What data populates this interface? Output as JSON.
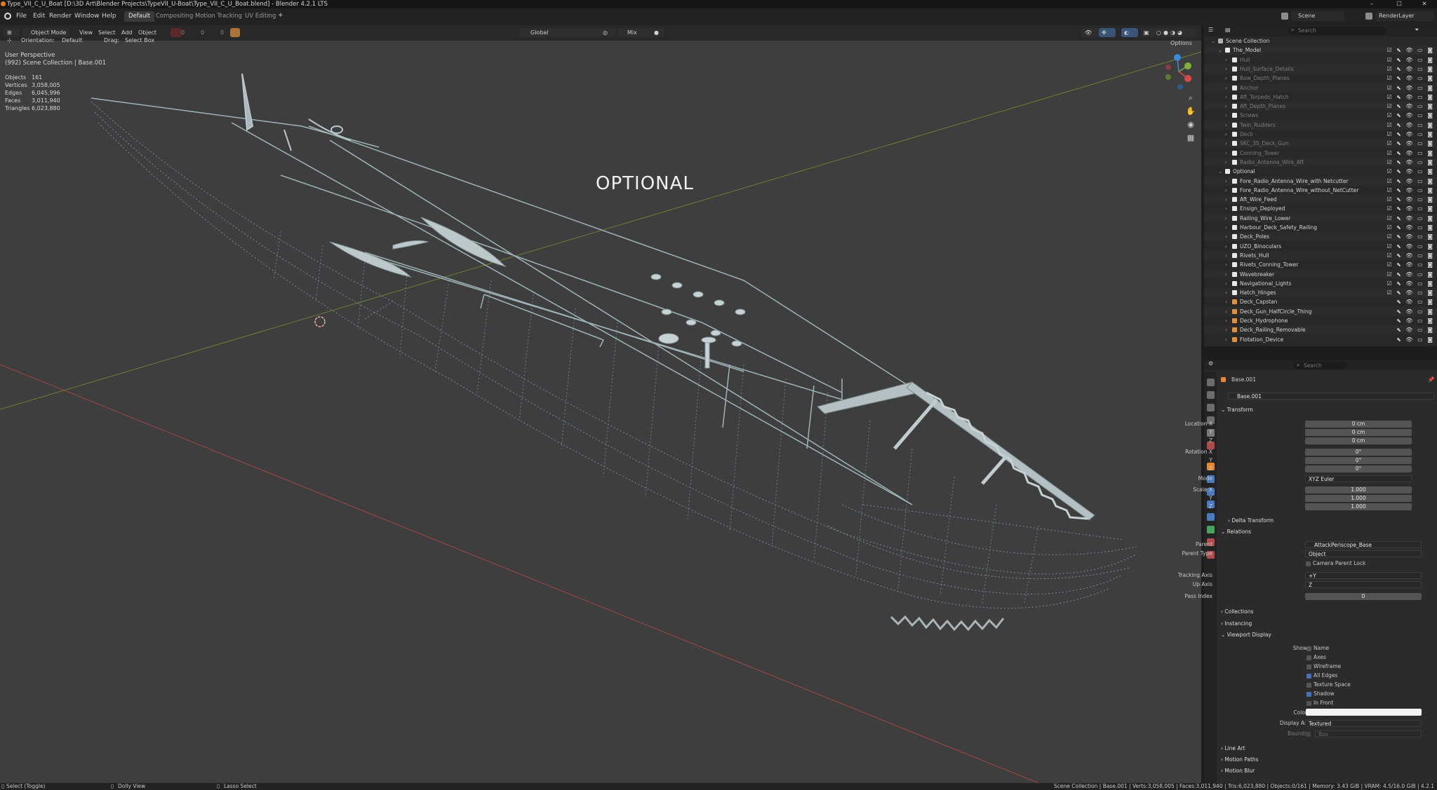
{
  "titlebar": {
    "title": "Type_VII_C_U_Boat [D:\\3D Art\\Blender Projects\\TypeVII_U-Boat\\Type_VII_C_U_Boat.blend] - Blender 4.2.1 LTS",
    "minimize": "–",
    "maximize": "☐",
    "close": "✕"
  },
  "menubar": {
    "items": [
      "File",
      "Edit",
      "Render",
      "Window",
      "Help"
    ],
    "workspaces": [
      "Default",
      "Compositing",
      "Motion Tracking",
      "UV Editing"
    ],
    "add_workspace": "+",
    "scene": "Scene",
    "view_layer": "RenderLayer"
  },
  "viewport_header": {
    "mode": "Object Mode",
    "menus": [
      "View",
      "Select",
      "Add",
      "Object"
    ],
    "transform_orientation": "Global",
    "proportional": "Mix",
    "options": "Options",
    "orientation_label": "Orientation:",
    "orientation_value": "Default",
    "drag_label": "Drag:",
    "drag_value": "Select Box",
    "counters": [
      "0",
      "0",
      "0"
    ]
  },
  "overlay": {
    "perspective": "User Perspective",
    "collection_info": "(992) Scene Collection | Base.001",
    "stats": [
      {
        "label": "Objects",
        "value": "161"
      },
      {
        "label": "Vertices",
        "value": "3,058,005"
      },
      {
        "label": "Edges",
        "value": "6,045,996"
      },
      {
        "label": "Faces",
        "value": "3,011,940"
      },
      {
        "label": "Triangles",
        "value": "6,023,880"
      }
    ],
    "center_label": "OPTIONAL"
  },
  "outliner": {
    "search_placeholder": "Search",
    "root": "Scene Collection",
    "model_collection": "The_Model",
    "model_children": [
      "Hull",
      "Hull_Surface_Details",
      "Bow_Depth_Planes",
      "Anchor",
      "Aft_Torpedo_Hatch",
      "Aft_Depth_Planes",
      "Screws",
      "Twin_Rudders",
      "Deck",
      "SKC_35_Deck_Gun",
      "Conning_Tower",
      "Radio_Antenna_Wire_Aft"
    ],
    "optional_collection": "Optional",
    "optional_children": [
      "Fore_Radio_Antenna_Wire_with Netcutter",
      "Fore_Radio_Antenna_Wire_without_NetCutter",
      "Aft_Wire_Feed",
      "Ensign_Deployed",
      "Railing_Wire_Lower",
      "Harbour_Deck_Safety_Railing",
      "Deck_Poles",
      "UZO_Binoculars",
      "Rivets_Hull",
      "Rivets_Conning_Tower",
      "Wavebreaker",
      "Navigational_Lights",
      "Hatch_Hinges",
      "Deck_Capstan",
      "Deck_Gun_HalfCircle_Thing",
      "Deck_Hydrophone",
      "Deck_Railing_Removable",
      "Flotation_Device"
    ]
  },
  "properties": {
    "search_placeholder": "Search",
    "object_name": "Base.001",
    "object_field": "Base.001",
    "transform": {
      "title": "Transform",
      "location_label": "Location X",
      "location": [
        "0 cm",
        "0 cm",
        "0 cm"
      ],
      "rotation_label": "Rotation X",
      "rotation": [
        "0°",
        "0°",
        "0°"
      ],
      "mode_label": "Mode",
      "mode": "XYZ Euler",
      "scale_label": "Scale X",
      "scale": [
        "1.000",
        "1.000",
        "1.000"
      ],
      "axis_y": "Y",
      "axis_z": "Z",
      "delta": "Delta Transform"
    },
    "relations": {
      "title": "Relations",
      "parent_label": "Parent",
      "parent": "AttackPeriscope_Base",
      "parent_type_label": "Parent Type",
      "parent_type": "Object",
      "camera_lock": "Camera Parent Lock",
      "tracking_axis_label": "Tracking Axis",
      "tracking_axis": "+Y",
      "up_axis_label": "Up Axis",
      "up_axis": "Z",
      "pass_index_label": "Pass Index",
      "pass_index": "0"
    },
    "collections": "Collections",
    "instancing": "Instancing",
    "viewport_display": {
      "title": "Viewport Display",
      "show_label": "Show",
      "options": [
        {
          "label": "Name",
          "checked": false
        },
        {
          "label": "Axes",
          "checked": false
        },
        {
          "label": "Wireframe",
          "checked": false
        },
        {
          "label": "All Edges",
          "checked": true
        },
        {
          "label": "Texture Space",
          "checked": false
        },
        {
          "label": "Shadow",
          "checked": true
        },
        {
          "label": "In Front",
          "checked": false
        }
      ],
      "color_label": "Color",
      "display_as_label": "Display As",
      "display_as": "Textured",
      "bounds_label": "Bounds",
      "bounds": "Box"
    },
    "line_art": "Line Art",
    "motion_paths": "Motion Paths",
    "motion_blur": "Motion Blur"
  },
  "statusbar": {
    "select": "Select (Toggle)",
    "dolly": "Dolly View",
    "lasso": "Lasso Select",
    "info": "Scene Collection | Base.001 | Verts:3,058,005 | Faces:3,011,940 | Tris:6,023,880 | Objects:0/161 | Memory: 3.43 GiB | VRAM: 4.5/16.0 GiB | 4.2.1"
  }
}
